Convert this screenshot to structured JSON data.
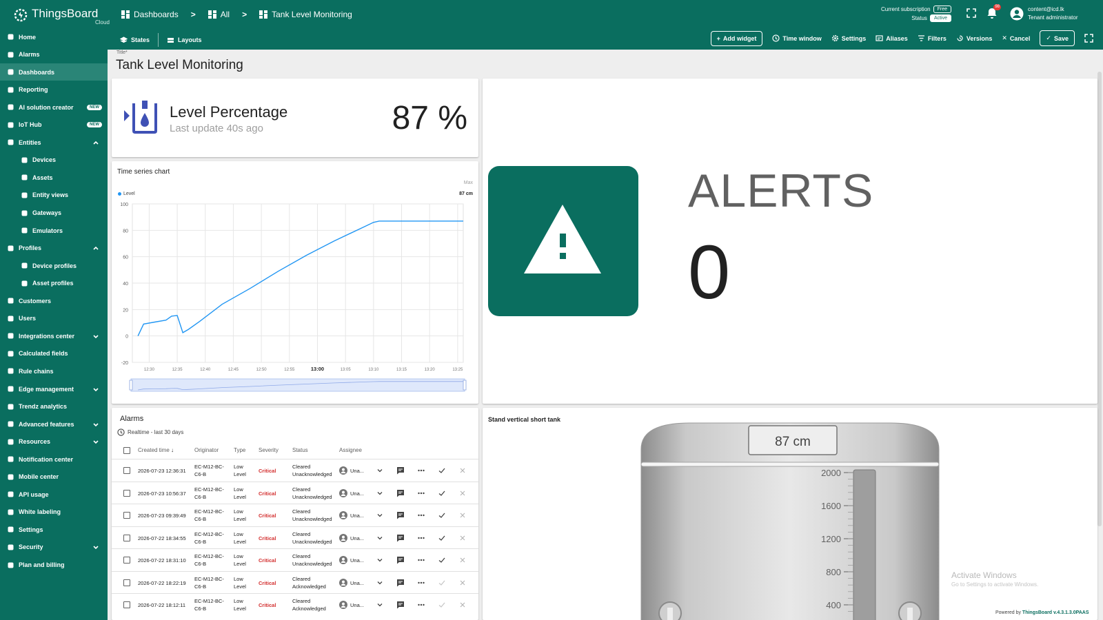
{
  "app": {
    "logo": "ThingsBoard",
    "logo_sub": "Cloud"
  },
  "breadcrumbs": [
    "Dashboards",
    "All",
    "Tank Level Monitoring"
  ],
  "subscription": {
    "label": "Current subscription",
    "plan": "Free",
    "status_label": "Status",
    "status": "Active"
  },
  "notifications": {
    "count": "98"
  },
  "user": {
    "email": "content@icd.lk",
    "role": "Tenant administrator"
  },
  "edit_toolbar": {
    "states": "States",
    "layouts": "Layouts",
    "add_widget": "Add widget",
    "time_window": "Time window",
    "settings": "Settings",
    "aliases": "Aliases",
    "filters": "Filters",
    "versions": "Versions",
    "cancel": "Cancel",
    "save": "Save"
  },
  "sidebar": {
    "items": [
      {
        "label": "Home",
        "icon": "home-icon"
      },
      {
        "label": "Alarms",
        "icon": "warning-icon"
      },
      {
        "label": "Dashboards",
        "icon": "dashboard-icon",
        "selected": true
      },
      {
        "label": "Reporting",
        "icon": "report-icon"
      },
      {
        "label": "AI solution creator",
        "icon": "sparkle-icon",
        "badge": "NEW"
      },
      {
        "label": "IoT Hub",
        "icon": "hub-icon",
        "badge": "NEW"
      },
      {
        "label": "Entities",
        "icon": "entities-icon",
        "expand": "up"
      },
      {
        "label": "Devices",
        "icon": "devices-icon",
        "sub": true
      },
      {
        "label": "Assets",
        "icon": "assets-icon",
        "sub": true
      },
      {
        "label": "Entity views",
        "icon": "views-icon",
        "sub": true
      },
      {
        "label": "Gateways",
        "icon": "gateway-icon",
        "sub": true
      },
      {
        "label": "Emulators",
        "icon": "emulator-icon",
        "sub": true
      },
      {
        "label": "Profiles",
        "icon": "profiles-icon",
        "expand": "up"
      },
      {
        "label": "Device profiles",
        "icon": "device-profile-icon",
        "sub": true
      },
      {
        "label": "Asset profiles",
        "icon": "asset-profile-icon",
        "sub": true
      },
      {
        "label": "Customers",
        "icon": "customers-icon"
      },
      {
        "label": "Users",
        "icon": "users-icon"
      },
      {
        "label": "Integrations center",
        "icon": "integrations-icon",
        "expand": "down"
      },
      {
        "label": "Calculated fields",
        "icon": "function-icon"
      },
      {
        "label": "Rule chains",
        "icon": "rule-chain-icon"
      },
      {
        "label": "Edge management",
        "icon": "edge-icon",
        "expand": "down"
      },
      {
        "label": "Trendz analytics",
        "icon": "trendz-icon"
      },
      {
        "label": "Advanced features",
        "icon": "tools-icon",
        "expand": "down"
      },
      {
        "label": "Resources",
        "icon": "folder-icon",
        "expand": "down"
      },
      {
        "label": "Notification center",
        "icon": "notification-icon"
      },
      {
        "label": "Mobile center",
        "icon": "mobile-icon"
      },
      {
        "label": "API usage",
        "icon": "api-icon"
      },
      {
        "label": "White labeling",
        "icon": "paint-icon"
      },
      {
        "label": "Settings",
        "icon": "gear-icon"
      },
      {
        "label": "Security",
        "icon": "shield-icon",
        "expand": "down"
      },
      {
        "label": "Plan and billing",
        "icon": "billing-icon"
      }
    ]
  },
  "dashboard": {
    "title_label": "Title*",
    "title": "Tank Level Monitoring"
  },
  "level_widget": {
    "title": "Level Percentage",
    "subtitle": "Last update 40s ago",
    "value": "87 %"
  },
  "alerts_widget": {
    "title": "ALERTS",
    "value": "0",
    "accent": "#0a6e5f"
  },
  "chart_widget": {
    "title": "Time series chart",
    "max_label": "Max",
    "max_value": "87 cm"
  },
  "chart_data": {
    "type": "line",
    "title": "Time series chart",
    "series": [
      {
        "name": "Level",
        "color": "#2196f3",
        "x": [
          "12:28",
          "12:29",
          "12:31",
          "12:33",
          "12:34",
          "12:35",
          "12:36",
          "12:37",
          "12:39",
          "12:43",
          "12:48",
          "12:53",
          "12:58",
          "13:03",
          "13:08",
          "13:10",
          "13:11",
          "13:15",
          "13:20",
          "13:26"
        ],
        "y": [
          0,
          9,
          10.5,
          12,
          15,
          15.5,
          2.5,
          5,
          11,
          24,
          36,
          49,
          61,
          72,
          82,
          86,
          87,
          87,
          87,
          87
        ]
      }
    ],
    "x_ticks": [
      "12:30",
      "12:35",
      "12:40",
      "12:45",
      "12:50",
      "12:55",
      "13:00",
      "13:05",
      "13:10",
      "13:15",
      "13:20",
      "13:25"
    ],
    "x_range": [
      "12:27",
      "13:26"
    ],
    "ylim": [
      -20,
      100
    ],
    "y_ticks": [
      -20,
      0,
      20,
      40,
      60,
      80,
      100
    ],
    "grid": true,
    "legend": "top-left"
  },
  "alarms_widget": {
    "title": "Alarms",
    "realtime": "Realtime - last 30 days",
    "columns": [
      "Created time",
      "Originator",
      "Type",
      "Severity",
      "Status",
      "Assignee"
    ],
    "rows": [
      {
        "time": "2026-07-23 12:36:31",
        "originator1": "EC-M12-BC-",
        "originator2": "C6-B",
        "type1": "Low",
        "type2": "Level",
        "severity": "Critical",
        "status1": "Cleared",
        "status2": "Unacknowledged",
        "assignee": "Una...",
        "ack_enabled": true
      },
      {
        "time": "2026-07-23 10:56:37",
        "originator1": "EC-M12-BC-",
        "originator2": "C6-B",
        "type1": "Low",
        "type2": "Level",
        "severity": "Critical",
        "status1": "Cleared",
        "status2": "Unacknowledged",
        "assignee": "Una...",
        "ack_enabled": true
      },
      {
        "time": "2026-07-23 09:39:49",
        "originator1": "EC-M12-BC-",
        "originator2": "C6-B",
        "type1": "Low",
        "type2": "Level",
        "severity": "Critical",
        "status1": "Cleared",
        "status2": "Unacknowledged",
        "assignee": "Una...",
        "ack_enabled": true
      },
      {
        "time": "2026-07-22 18:34:55",
        "originator1": "EC-M12-BC-",
        "originator2": "C6-B",
        "type1": "Low",
        "type2": "Level",
        "severity": "Critical",
        "status1": "Cleared",
        "status2": "Unacknowledged",
        "assignee": "Una...",
        "ack_enabled": true
      },
      {
        "time": "2026-07-22 18:31:10",
        "originator1": "EC-M12-BC-",
        "originator2": "C6-B",
        "type1": "Low",
        "type2": "Level",
        "severity": "Critical",
        "status1": "Cleared",
        "status2": "Unacknowledged",
        "assignee": "Una...",
        "ack_enabled": true
      },
      {
        "time": "2026-07-22 18:22:19",
        "originator1": "EC-M12-BC-",
        "originator2": "C6-B",
        "type1": "Low",
        "type2": "Level",
        "severity": "Critical",
        "status1": "Cleared",
        "status2": "Acknowledged",
        "assignee": "Una...",
        "ack_enabled": false
      },
      {
        "time": "2026-07-22 18:12:11",
        "originator1": "EC-M12-BC-",
        "originator2": "C6-B",
        "type1": "Low",
        "type2": "Level",
        "severity": "Critical",
        "status1": "Cleared",
        "status2": "Acknowledged",
        "assignee": "Una...",
        "ack_enabled": false
      }
    ]
  },
  "tank_widget": {
    "title": "Stand vertical short tank",
    "value": "87 cm",
    "scale": [
      "2000",
      "1600",
      "1200",
      "800",
      "400"
    ]
  },
  "overlay": {
    "activate_title": "Activate Windows",
    "activate_sub": "Go to Settings to activate Windows.",
    "powered_prefix": "Powered by",
    "powered_brand": "ThingsBoard v.4.3.1.3.0PAAS"
  }
}
